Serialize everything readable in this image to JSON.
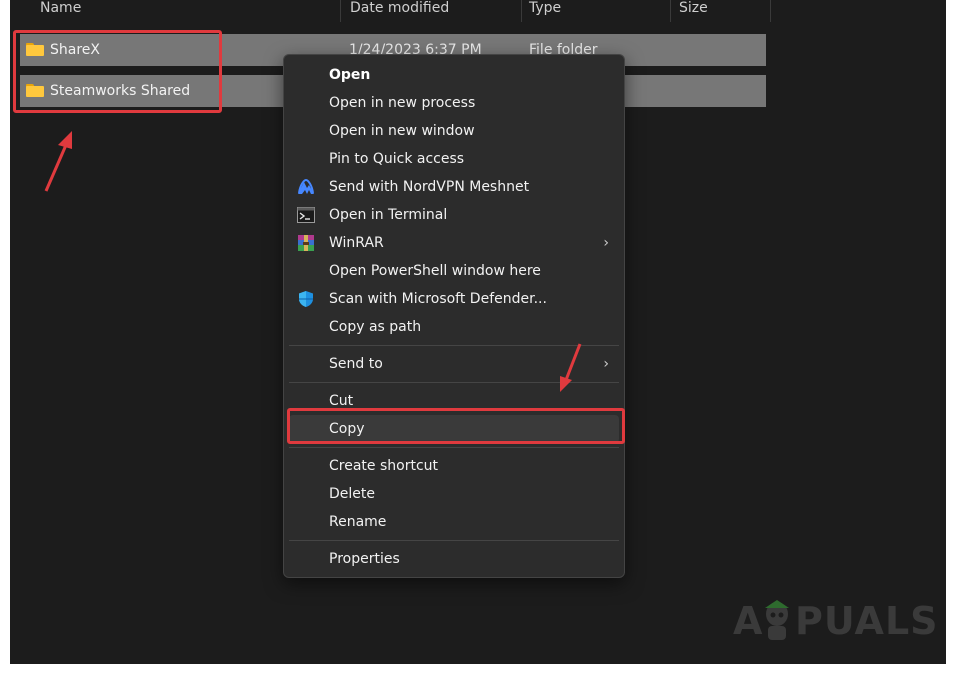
{
  "columns": {
    "name": "Name",
    "date": "Date modified",
    "type": "Type",
    "size": "Size"
  },
  "files": [
    {
      "name": "ShareX",
      "date": "1/24/2023 6:37 PM",
      "type": "File folder",
      "icon": "folder-icon"
    },
    {
      "name": "Steamworks Shared",
      "date": "",
      "type": "",
      "icon": "folder-icon"
    }
  ],
  "context_menu": {
    "open": "Open",
    "open_new_process": "Open in new process",
    "open_new_window": "Open in new window",
    "pin_quick_access": "Pin to Quick access",
    "send_nordvpn": "Send with NordVPN Meshnet",
    "open_terminal": "Open in Terminal",
    "winrar": "WinRAR",
    "open_powershell": "Open PowerShell window here",
    "scan_defender": "Scan with Microsoft Defender...",
    "copy_as_path": "Copy as path",
    "send_to": "Send to",
    "cut": "Cut",
    "copy": "Copy",
    "create_shortcut": "Create shortcut",
    "delete": "Delete",
    "rename": "Rename",
    "properties": "Properties",
    "submenu_chevron": "›"
  },
  "watermark": {
    "left": "A",
    "right": "PUALS"
  },
  "colors": {
    "background": "#1c1c1c",
    "selected_row": "#777777",
    "menu_bg": "#2c2c2c",
    "annotation_red": "#e03a3e",
    "folder_yellow": "#ffc83d",
    "nordvpn_blue": "#4687ff",
    "defender_blue": "#1e90e0"
  }
}
